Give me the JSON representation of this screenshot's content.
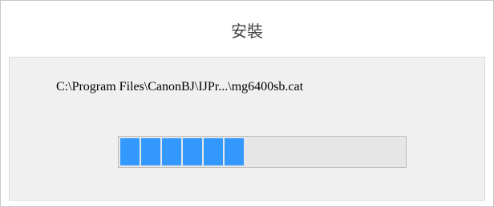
{
  "dialog": {
    "title": "安裝"
  },
  "install": {
    "current_file": "C:\\Program Files\\CanonBJ\\IJPr...\\mg6400sb.cat",
    "progress_fraction": 0.5
  },
  "colors": {
    "progress_fill": "#3399ff",
    "progress_track": "#e6e6e6",
    "panel_background": "#f0f0f0"
  }
}
